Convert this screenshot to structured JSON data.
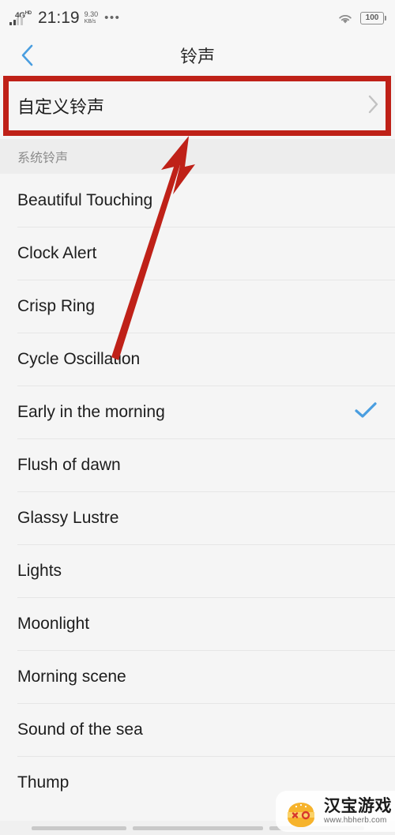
{
  "status_bar": {
    "network_type": "4G",
    "network_type_sup": "HD",
    "time": "21:19",
    "net_speed_value": "9.30",
    "net_speed_unit": "KB/s",
    "overflow_dots": "•••",
    "battery_level": "100"
  },
  "header": {
    "title": "铃声",
    "back_icon": "chevron-left-icon",
    "accent_color": "#4a9ee0"
  },
  "custom_ringtone": {
    "label": "自定义铃声",
    "chevron_icon": "chevron-right-icon",
    "highlight_color": "#bf2118"
  },
  "section": {
    "title": "系统铃声"
  },
  "ringtones": [
    {
      "name": "Beautiful Touching",
      "selected": false
    },
    {
      "name": "Clock Alert",
      "selected": false
    },
    {
      "name": "Crisp Ring",
      "selected": false
    },
    {
      "name": "Cycle Oscillation",
      "selected": false
    },
    {
      "name": "Early in the morning",
      "selected": true
    },
    {
      "name": "Flush of dawn",
      "selected": false
    },
    {
      "name": "Glassy Lustre",
      "selected": false
    },
    {
      "name": "Lights",
      "selected": false
    },
    {
      "name": "Moonlight",
      "selected": false
    },
    {
      "name": "Morning scene",
      "selected": false
    },
    {
      "name": "Sound of the sea",
      "selected": false
    },
    {
      "name": "Thump",
      "selected": false
    }
  ],
  "selected_check_icon": "checkmark-icon",
  "selected_check_color": "#4a9ee0",
  "annotation": {
    "arrow_icon": "red-arrow-pointing-up-right",
    "arrow_color": "#bf2118"
  },
  "watermark": {
    "title": "汉宝游戏",
    "url": "www.hbherb.com",
    "logo_icon": "burger-logo-icon",
    "logo_color": "#f6b32c"
  }
}
